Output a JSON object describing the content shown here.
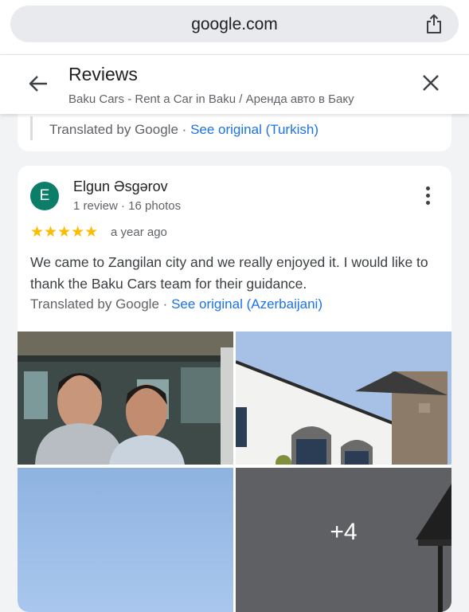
{
  "browser": {
    "url": "google.com"
  },
  "header": {
    "title": "Reviews",
    "subtitle": "Baku Cars - Rent a Car in Baku / Аренда авто в Баку"
  },
  "previous_review": {
    "translated_by": "Translated by Google",
    "separator": "·",
    "see_original": "See original (Turkish)"
  },
  "review": {
    "avatar_letter": "E",
    "avatar_color": "#0b7d69",
    "author": "Elgun Əsgərov",
    "author_meta": "1 review · 16 photos",
    "stars": "★★★★★",
    "rating": 5,
    "time": "a year ago",
    "text": "We came to Zangilan city and we really enjoyed it. I would like to thank the Baku Cars team for their guidance.",
    "translated_by": "Translated by Google",
    "separator": "·",
    "see_original": "See original (Azerbaijani)",
    "more_photos_label": "+4"
  }
}
